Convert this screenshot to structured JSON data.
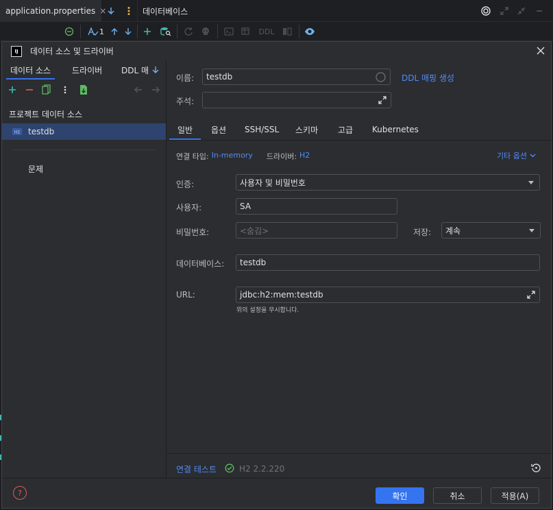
{
  "editor": {
    "file_tab": "application.properties",
    "close_glyph": "×",
    "tool_window_title": "데이터베이스",
    "inspection_count": "1",
    "ddl_label": "DDL"
  },
  "dialog": {
    "title": "데이터 소스 및 드라이버",
    "logo_text": "IJ",
    "left_tabs": [
      "데이터 소스",
      "드라이버",
      "DDL 매"
    ],
    "section_title": "프로젝트 데이터 소스",
    "data_sources": [
      {
        "name": "testdb",
        "selected": true
      }
    ],
    "problems_label": "문제",
    "name_label": "이름:",
    "name_value": "testdb",
    "ddl_mapping_link": "DDL 매핑 생성",
    "comment_label": "주석:",
    "comment_value": "",
    "tabs": [
      "일반",
      "옵션",
      "SSH/SSL",
      "스키마",
      "고급",
      "Kubernetes"
    ],
    "active_tab": "일반",
    "connection_type_label": "연결 타입:",
    "connection_type_value": "In-memory",
    "driver_label": "드라이버:",
    "driver_value": "H2",
    "more_options": "기타 옵션",
    "auth_label": "인증:",
    "auth_value": "사용자 및 비밀번호",
    "user_label": "사용자:",
    "user_value": "SA",
    "password_label": "비밀번호:",
    "password_placeholder": "<숨김>",
    "save_label": "저장:",
    "save_value": "계속",
    "database_label": "데이터베이스:",
    "database_value": "testdb",
    "url_label": "URL:",
    "url_value": "jdbc:h2:mem:testdb",
    "url_hint": "위의 설정을 무시합니다.",
    "test_connection": "연결 테스트",
    "driver_version": "H2 2.2.220",
    "help_glyph": "?",
    "ok": "확인",
    "cancel": "취소",
    "apply": "적용(A)"
  },
  "colors": {
    "accent": "#3574f0",
    "link": "#548af7",
    "success": "#5fb865",
    "selection": "#2e436e",
    "error": "#db5c5c",
    "teal": "#3fb8af"
  }
}
